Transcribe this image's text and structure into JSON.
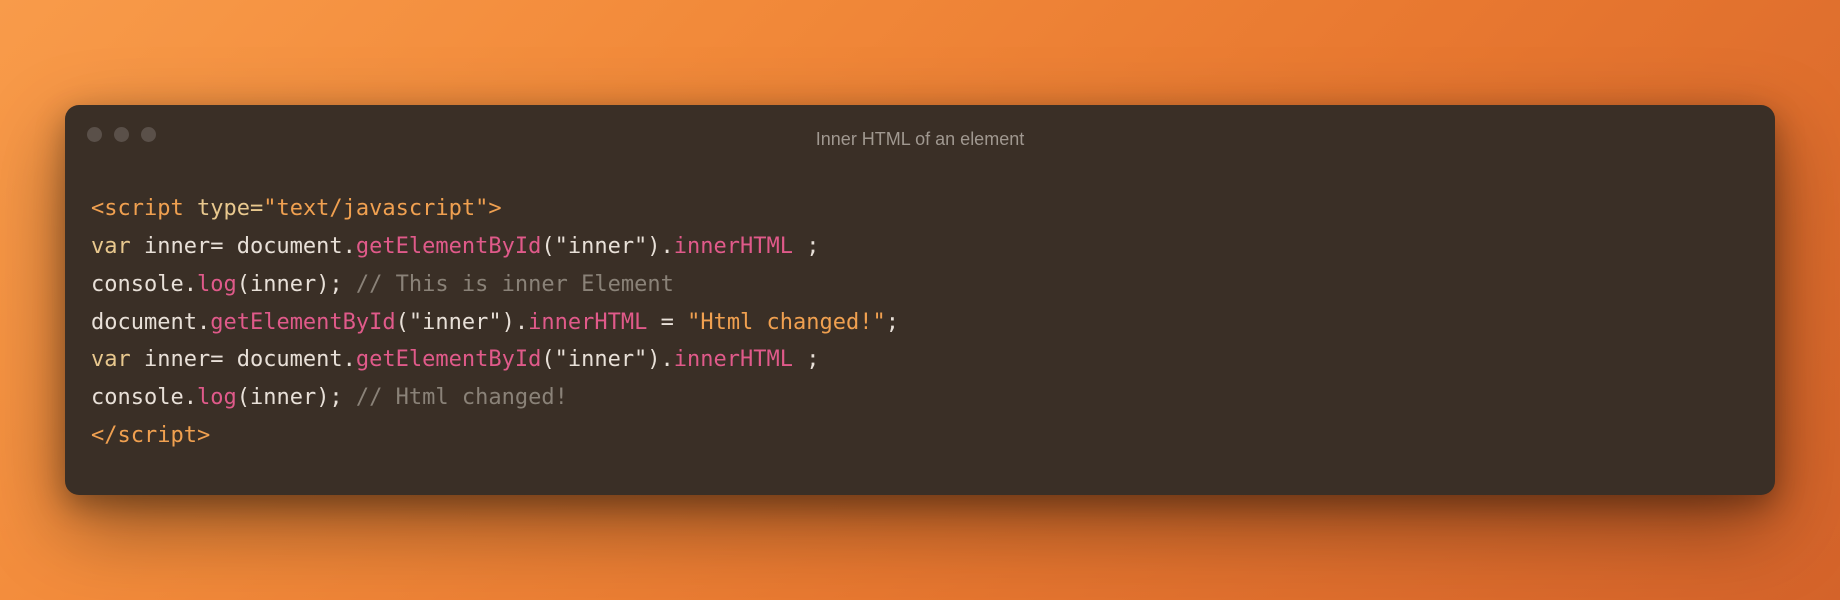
{
  "window": {
    "title": "Inner HTML of an element"
  },
  "code": {
    "line1": {
      "open": "<script",
      "attr": " type=",
      "val": "\"text/javascript\"",
      "close": ">"
    },
    "line2": {
      "kw": "var ",
      "ident": "inner= document.",
      "method": "getElementById",
      "args": "(\"inner\").",
      "prop": "innerHTML",
      "tail": " ;"
    },
    "line3": {
      "pre": "console.",
      "method": "log",
      "args": "(inner);",
      "comment": " // This is inner Element"
    },
    "line4": {
      "pre": "document.",
      "method": "getElementById",
      "args": "(\"inner\").",
      "prop": "innerHTML",
      "assign": " = ",
      "str": "\"Html changed!\"",
      "tail": ";"
    },
    "line5": {
      "kw": "var ",
      "ident": "inner= document.",
      "method": "getElementById",
      "args": "(\"inner\").",
      "prop": "innerHTML",
      "tail": " ;"
    },
    "line6": {
      "pre": "console.",
      "method": "log",
      "args": "(inner);",
      "comment": " // Html changed!"
    },
    "line7": {
      "close": "</scr"
    },
    "line7b": {
      "close2": "ipt>"
    }
  }
}
